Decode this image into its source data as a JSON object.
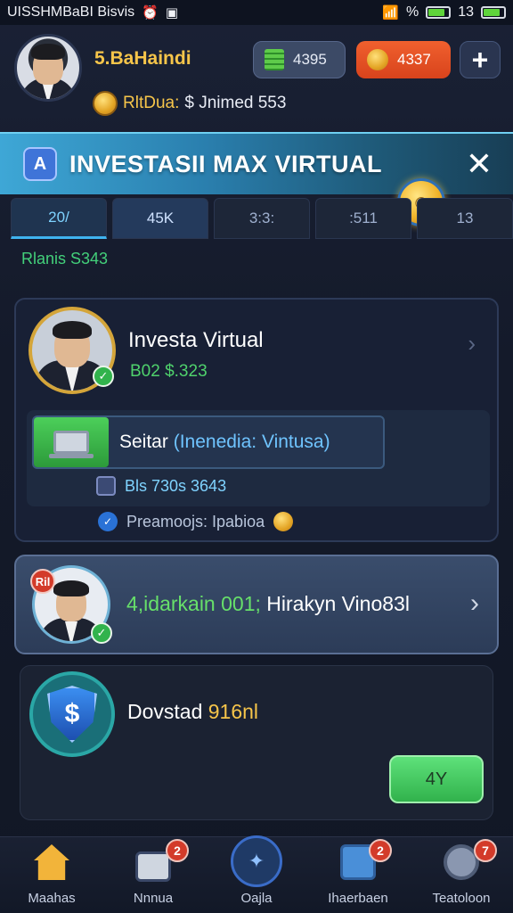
{
  "status_bar": {
    "left_text": "UISSHMBaBI Bisvis",
    "signal_text": "%",
    "time": "13"
  },
  "header": {
    "username": "5.BaHaindi",
    "balance_label": "RltDua:",
    "balance_value": "$ Jnimed 553",
    "cash_amount": "4395",
    "coin_amount": "4337",
    "add_label": "+"
  },
  "banner": {
    "logo": "A",
    "title": "INVESTASII MAX VIRTUAL",
    "close": "✕"
  },
  "tabs": [
    {
      "label": "20/"
    },
    {
      "label": "45K"
    },
    {
      "label": "3:3:"
    },
    {
      "label": ":511"
    },
    {
      "label": "13"
    }
  ],
  "section_label": "Rlanis S343",
  "card1": {
    "title": "Investa Virtual",
    "subtitle": "B02 $.323",
    "sim_text_prefix": "Seitar",
    "sim_text_highlight": "(Inenedia: Vintusa)",
    "fund_text": "Bls 730s 3643",
    "promo_text": "Preamoojs: Ipabioa"
  },
  "card2": {
    "badge": "Ril",
    "text_green": "4,idarkain 001;",
    "text_white": "Hirakyn Vino83l"
  },
  "card3": {
    "title_prefix": "Dovstad",
    "title_gold": "916nl",
    "button": "4Y"
  },
  "nav": [
    {
      "label": "Maahas",
      "badge": ""
    },
    {
      "label": "Nnnua",
      "badge": "2"
    },
    {
      "label": "Oajla",
      "badge": ""
    },
    {
      "label": "Ihaerbaen",
      "badge": "2"
    },
    {
      "label": "Teatoloon",
      "badge": "7"
    }
  ],
  "colors": {
    "accent_gold": "#f6c54a",
    "accent_green": "#43d07a",
    "banner_blue": "#3ea7d6",
    "coin_orange": "#e4502a"
  }
}
